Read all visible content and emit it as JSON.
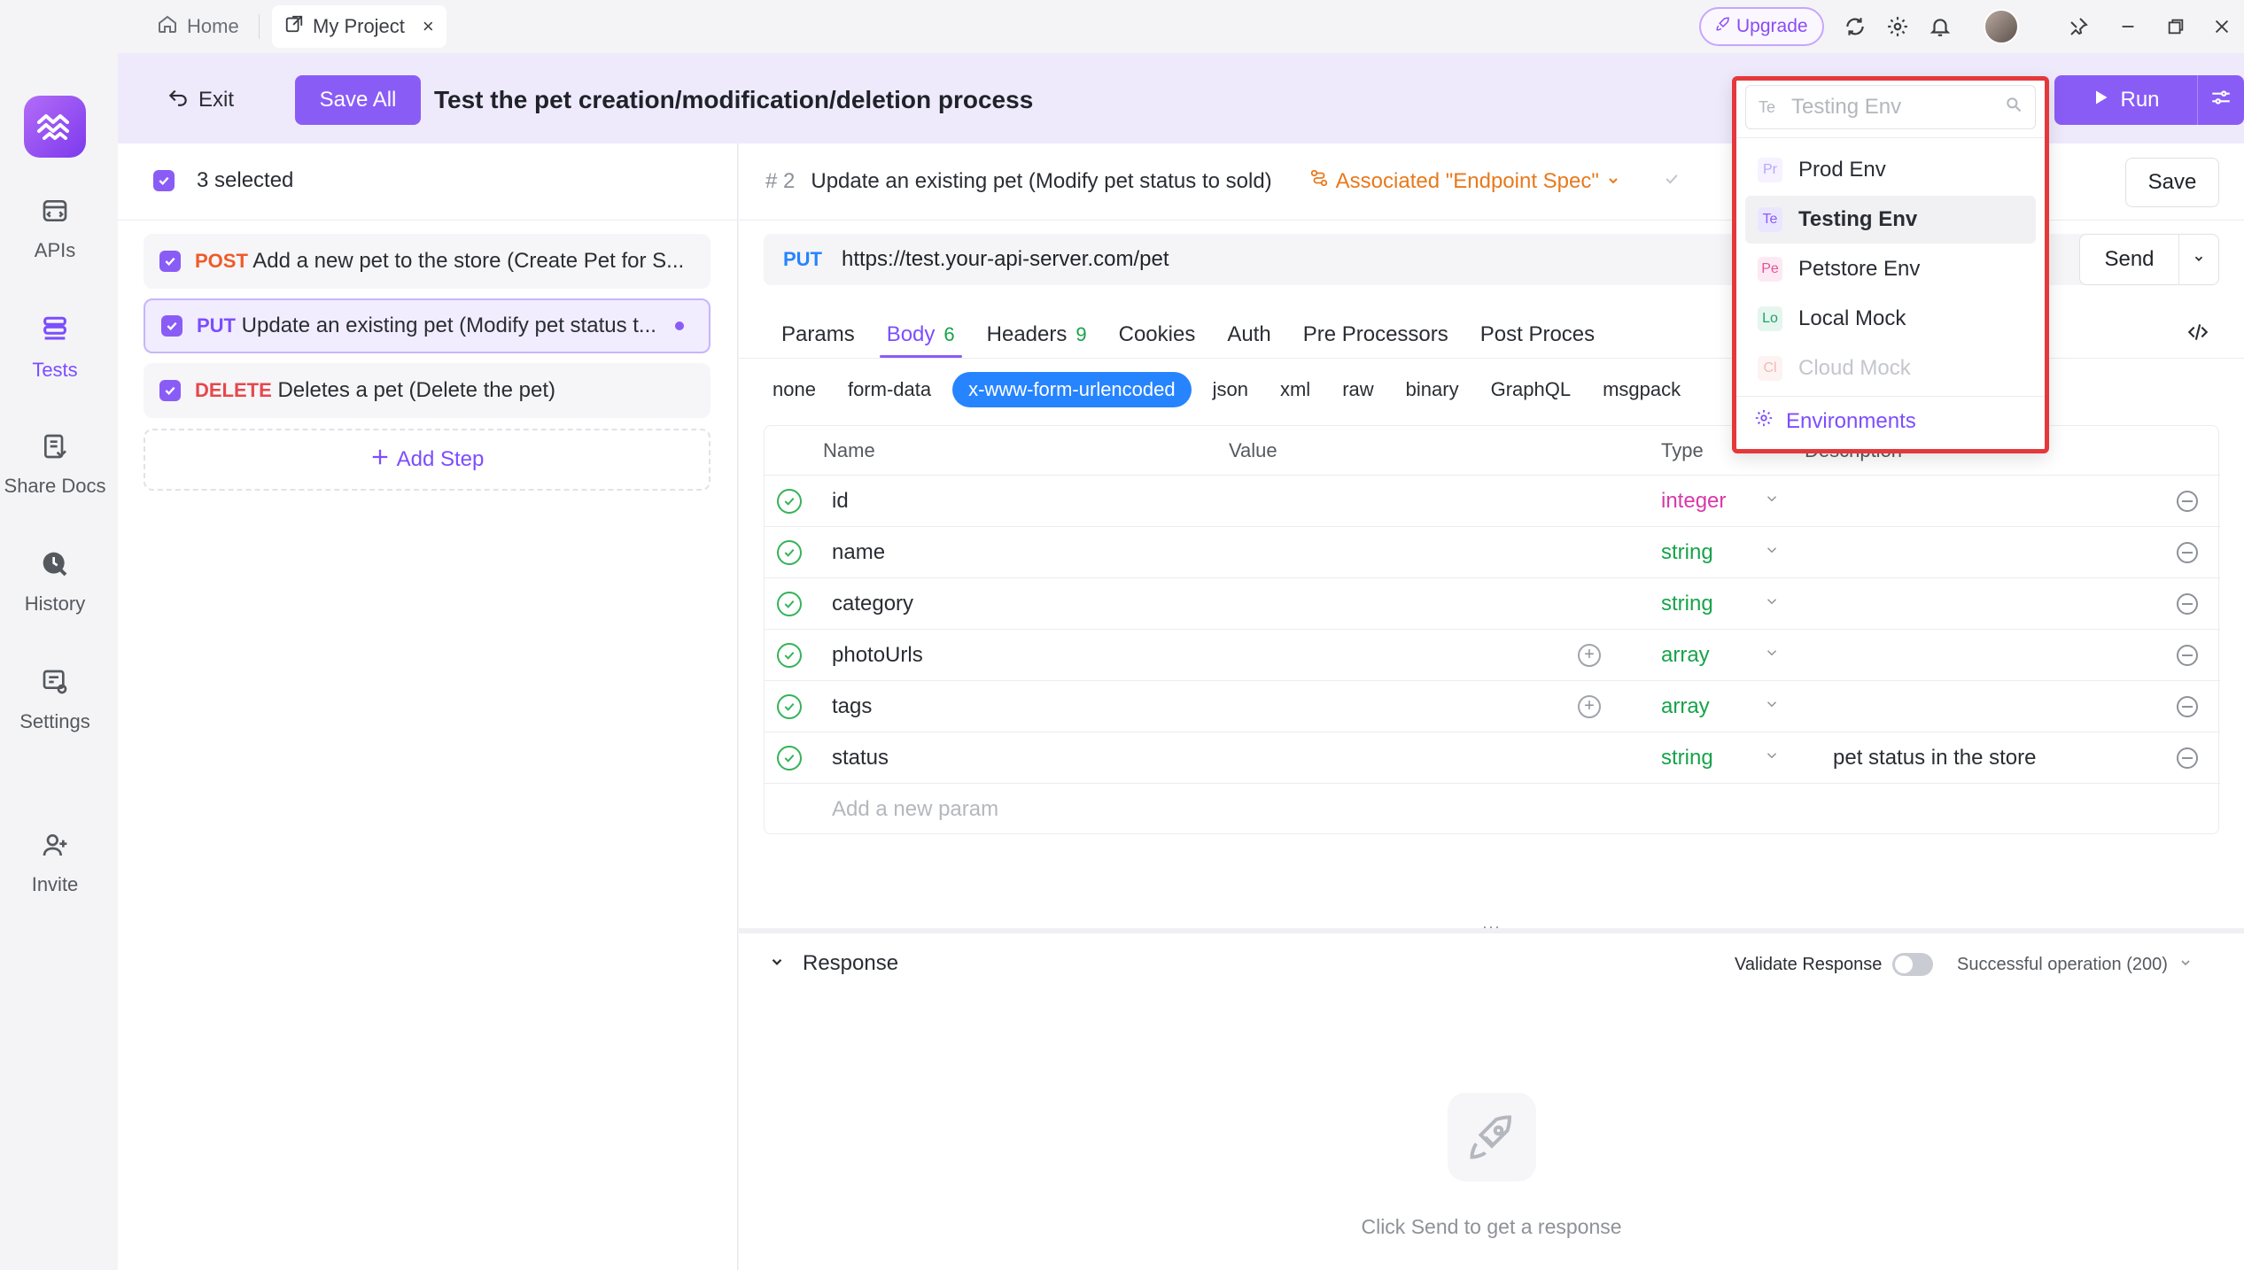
{
  "titlebar": {
    "home_label": "Home",
    "project_tab_label": "My Project",
    "close_glyph": "×",
    "upgrade_label": "Upgrade"
  },
  "rail": {
    "items": [
      {
        "label": "APIs",
        "icon": "apis-icon"
      },
      {
        "label": "Tests",
        "icon": "tests-icon"
      },
      {
        "label": "Share Docs",
        "icon": "share-docs-icon"
      },
      {
        "label": "History",
        "icon": "history-icon"
      },
      {
        "label": "Settings",
        "icon": "settings-icon"
      },
      {
        "label": "Invite",
        "icon": "invite-icon"
      }
    ],
    "active": "Tests"
  },
  "header": {
    "exit_label": "Exit",
    "save_all_label": "Save All",
    "title": "Test the pet creation/modification/deletion process",
    "run_label": "Run"
  },
  "steps": {
    "selected_label": "3 selected",
    "items": [
      {
        "method": "POST",
        "text": "Add a new pet to the store (Create Pet for S..."
      },
      {
        "method": "PUT",
        "text": "Update an existing pet (Modify pet status t..."
      },
      {
        "method": "DELETE",
        "text": "Deletes a pet (Delete the pet)"
      }
    ],
    "add_step_label": "Add Step"
  },
  "editor": {
    "step_number": "2",
    "step_title": "Update an existing pet (Modify pet status to sold)",
    "associated_label": "Associated \"Endpoint Spec\"",
    "save_label": "Save",
    "method": "PUT",
    "url": "https://test.your-api-server.com/pet",
    "send_label": "Send",
    "tabs": [
      {
        "label": "Params",
        "count": ""
      },
      {
        "label": "Body",
        "count": "6"
      },
      {
        "label": "Headers",
        "count": "9"
      },
      {
        "label": "Cookies",
        "count": ""
      },
      {
        "label": "Auth",
        "count": ""
      },
      {
        "label": "Pre Processors",
        "count": ""
      },
      {
        "label": "Post Proces",
        "count": ""
      }
    ],
    "body_types": [
      "none",
      "form-data",
      "x-www-form-urlencoded",
      "json",
      "xml",
      "raw",
      "binary",
      "GraphQL",
      "msgpack"
    ],
    "active_body_type": "x-www-form-urlencoded",
    "table_headers": {
      "name": "Name",
      "value": "Value",
      "type": "Type",
      "description": "Description"
    },
    "params": [
      {
        "name": "id",
        "type": "integer",
        "description": ""
      },
      {
        "name": "name",
        "type": "string",
        "description": ""
      },
      {
        "name": "category",
        "type": "string",
        "description": ""
      },
      {
        "name": "photoUrls",
        "type": "array",
        "description": ""
      },
      {
        "name": "tags",
        "type": "array",
        "description": ""
      },
      {
        "name": "status",
        "type": "string",
        "description": "pet status in the store"
      }
    ],
    "add_param_placeholder": "Add a new param"
  },
  "response": {
    "title": "Response",
    "validate_label": "Validate Response",
    "validate_on": false,
    "status_option": "Successful operation (200)",
    "hint": "Click Send to get a response"
  },
  "env_dropdown": {
    "search_abbr": "Te",
    "search_placeholder": "Testing Env",
    "options": [
      {
        "abbr": "Pr",
        "label": "Prod Env",
        "color": "#8a5cf6",
        "bg": "#f3efff"
      },
      {
        "abbr": "Te",
        "label": "Testing Env",
        "color": "#8a5cf6",
        "bg": "#ebe6ff"
      },
      {
        "abbr": "Pe",
        "label": "Petstore Env",
        "color": "#e0559b",
        "bg": "#fde9f3"
      },
      {
        "abbr": "Lo",
        "label": "Local Mock",
        "color": "#22a06b",
        "bg": "#e5f6ee"
      },
      {
        "abbr": "Cl",
        "label": "Cloud Mock",
        "color": "#e8a39f",
        "bg": "#fdf0ef"
      }
    ],
    "selected": "Testing Env",
    "environments_link": "Environments"
  },
  "colors": {
    "accent": "#8a5cf6",
    "highlight_border": "#e5383b",
    "body_type_active": "#2684ff"
  }
}
